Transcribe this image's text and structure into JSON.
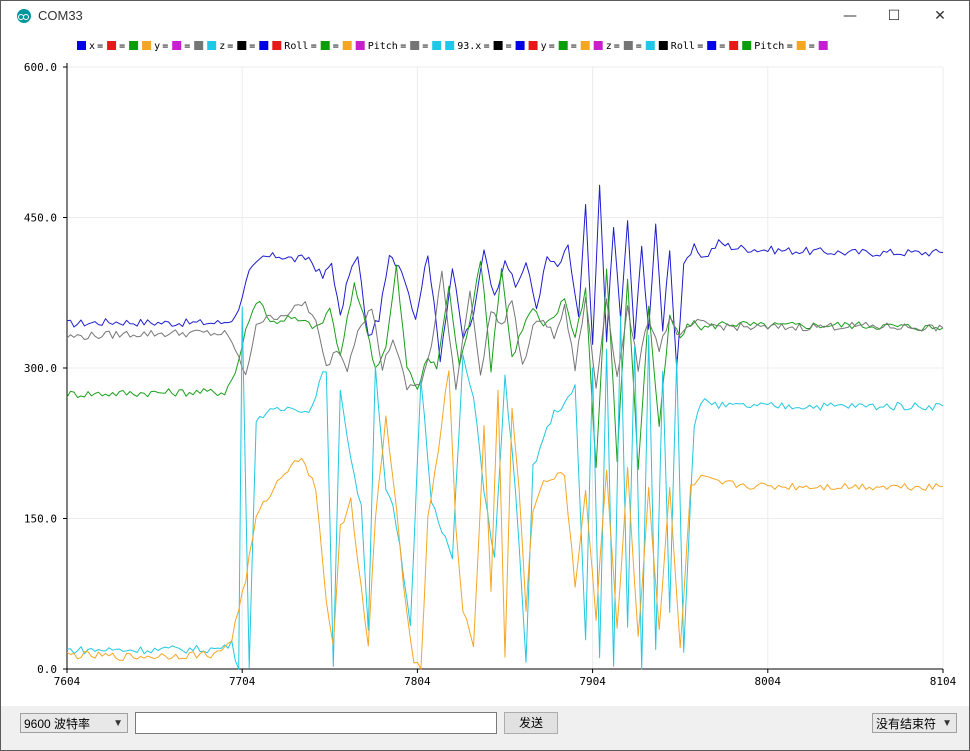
{
  "window": {
    "title": "COM33",
    "minimize": "—",
    "maximize": "☐",
    "close": "✕"
  },
  "legend": [
    {
      "label": "x",
      "color": "#0000e6",
      "sep": "="
    },
    {
      "label": "",
      "color": "#e61919",
      "sep": "="
    },
    {
      "label": "",
      "color": "#0a9e0a",
      "sep": ""
    },
    {
      "label": "y",
      "color": "#f5a623",
      "sep": "="
    },
    {
      "label": "",
      "color": "#c81ecf",
      "sep": "="
    },
    {
      "label": "",
      "color": "#757575",
      "sep": ""
    },
    {
      "label": "z",
      "color": "#1ec8e6",
      "sep": "="
    },
    {
      "label": "",
      "color": "#000000",
      "sep": "="
    },
    {
      "label": "",
      "color": "#0000e6",
      "sep": ""
    },
    {
      "label": "Roll",
      "color": "#e61919",
      "sep": "="
    },
    {
      "label": "",
      "color": "#0a9e0a",
      "sep": "="
    },
    {
      "label": "",
      "color": "#f5a623",
      "sep": ""
    },
    {
      "label": "Pitch",
      "color": "#c81ecf",
      "sep": "="
    },
    {
      "label": "",
      "color": "#757575",
      "sep": "="
    },
    {
      "label": "",
      "color": "#1ec8e6",
      "sep": ""
    },
    {
      "label": "93.x",
      "color": "#1ec8e6",
      "sep": "="
    },
    {
      "label": "",
      "color": "#000000",
      "sep": "="
    },
    {
      "label": "",
      "color": "#0000e6",
      "sep": ""
    },
    {
      "label": "y",
      "color": "#e61919",
      "sep": "="
    },
    {
      "label": "",
      "color": "#0a9e0a",
      "sep": "="
    },
    {
      "label": "",
      "color": "#f5a623",
      "sep": ""
    },
    {
      "label": "z",
      "color": "#c81ecf",
      "sep": "="
    },
    {
      "label": "",
      "color": "#757575",
      "sep": "="
    },
    {
      "label": "",
      "color": "#1ec8e6",
      "sep": ""
    },
    {
      "label": "Roll",
      "color": "#000000",
      "sep": "="
    },
    {
      "label": "",
      "color": "#0000e6",
      "sep": "="
    },
    {
      "label": "",
      "color": "#e61919",
      "sep": ""
    },
    {
      "label": "Pitch",
      "color": "#0a9e0a",
      "sep": "="
    },
    {
      "label": "",
      "color": "#f5a623",
      "sep": "="
    },
    {
      "label": "",
      "color": "#c81ecf",
      "sep": ""
    }
  ],
  "chart_data": {
    "type": "line",
    "title": "",
    "xlabel": "",
    "ylabel": "",
    "xlim": [
      7604,
      8104
    ],
    "ylim": [
      0,
      600
    ],
    "x_ticks": [
      "7604",
      "7704",
      "7804",
      "7904",
      "8004",
      "8104"
    ],
    "y_ticks": [
      "0.0",
      "150.0",
      "300.0",
      "450.0",
      "600.0"
    ],
    "grid": true,
    "series": [
      {
        "color": "#1e1ecf",
        "anchors": [
          [
            7604,
            344
          ],
          [
            7630,
            346
          ],
          [
            7660,
            345
          ],
          [
            7692,
            345
          ],
          [
            7700,
            350
          ],
          [
            7708,
            395
          ],
          [
            7716,
            410
          ],
          [
            7725,
            412
          ],
          [
            7734,
            408
          ],
          [
            7742,
            410
          ],
          [
            7750,
            390
          ],
          [
            7755,
            405
          ],
          [
            7760,
            350
          ],
          [
            7765,
            395
          ],
          [
            7770,
            410
          ],
          [
            7776,
            330
          ],
          [
            7782,
            350
          ],
          [
            7788,
            410
          ],
          [
            7795,
            400
          ],
          [
            7803,
            350
          ],
          [
            7810,
            415
          ],
          [
            7817,
            310
          ],
          [
            7824,
            400
          ],
          [
            7830,
            330
          ],
          [
            7836,
            350
          ],
          [
            7842,
            420
          ],
          [
            7848,
            370
          ],
          [
            7854,
            410
          ],
          [
            7860,
            380
          ],
          [
            7866,
            405
          ],
          [
            7872,
            360
          ],
          [
            7878,
            410
          ],
          [
            7884,
            400
          ],
          [
            7890,
            420
          ],
          [
            7896,
            350
          ],
          [
            7900,
            460
          ],
          [
            7904,
            320
          ],
          [
            7908,
            480
          ],
          [
            7912,
            330
          ],
          [
            7916,
            440
          ],
          [
            7920,
            350
          ],
          [
            7924,
            445
          ],
          [
            7928,
            330
          ],
          [
            7932,
            420
          ],
          [
            7936,
            340
          ],
          [
            7940,
            440
          ],
          [
            7944,
            340
          ],
          [
            7948,
            420
          ],
          [
            7952,
            300
          ],
          [
            7956,
            400
          ],
          [
            7962,
            420
          ],
          [
            7968,
            410
          ],
          [
            7976,
            425
          ],
          [
            7985,
            420
          ],
          [
            8000,
            418
          ],
          [
            8050,
            415
          ],
          [
            8104,
            415
          ]
        ]
      },
      {
        "color": "#1a9e1a",
        "anchors": [
          [
            7604,
            274
          ],
          [
            7640,
            275
          ],
          [
            7680,
            276
          ],
          [
            7694,
            276
          ],
          [
            7700,
            295
          ],
          [
            7708,
            350
          ],
          [
            7714,
            370
          ],
          [
            7720,
            345
          ],
          [
            7730,
            350
          ],
          [
            7740,
            345
          ],
          [
            7748,
            340
          ],
          [
            7754,
            360
          ],
          [
            7760,
            310
          ],
          [
            7768,
            385
          ],
          [
            7775,
            340
          ],
          [
            7780,
            300
          ],
          [
            7786,
            320
          ],
          [
            7792,
            400
          ],
          [
            7798,
            300
          ],
          [
            7804,
            280
          ],
          [
            7810,
            310
          ],
          [
            7815,
            300
          ],
          [
            7822,
            380
          ],
          [
            7828,
            300
          ],
          [
            7834,
            350
          ],
          [
            7840,
            410
          ],
          [
            7846,
            300
          ],
          [
            7852,
            400
          ],
          [
            7858,
            310
          ],
          [
            7864,
            340
          ],
          [
            7870,
            360
          ],
          [
            7876,
            340
          ],
          [
            7882,
            350
          ],
          [
            7888,
            370
          ],
          [
            7894,
            330
          ],
          [
            7900,
            380
          ],
          [
            7906,
            200
          ],
          [
            7912,
            400
          ],
          [
            7918,
            210
          ],
          [
            7924,
            390
          ],
          [
            7930,
            200
          ],
          [
            7936,
            360
          ],
          [
            7942,
            240
          ],
          [
            7948,
            350
          ],
          [
            7954,
            330
          ],
          [
            7960,
            345
          ],
          [
            7968,
            340
          ],
          [
            7980,
            345
          ],
          [
            8000,
            342
          ],
          [
            8050,
            343
          ],
          [
            8104,
            340
          ]
        ]
      },
      {
        "color": "#777777",
        "anchors": [
          [
            7604,
            331
          ],
          [
            7640,
            334
          ],
          [
            7680,
            335
          ],
          [
            7694,
            334
          ],
          [
            7700,
            320
          ],
          [
            7706,
            290
          ],
          [
            7712,
            345
          ],
          [
            7720,
            350
          ],
          [
            7730,
            355
          ],
          [
            7740,
            365
          ],
          [
            7746,
            345
          ],
          [
            7752,
            300
          ],
          [
            7758,
            320
          ],
          [
            7764,
            300
          ],
          [
            7770,
            340
          ],
          [
            7778,
            360
          ],
          [
            7784,
            300
          ],
          [
            7790,
            330
          ],
          [
            7798,
            280
          ],
          [
            7806,
            285
          ],
          [
            7812,
            320
          ],
          [
            7818,
            395
          ],
          [
            7826,
            280
          ],
          [
            7834,
            380
          ],
          [
            7840,
            290
          ],
          [
            7846,
            360
          ],
          [
            7852,
            340
          ],
          [
            7858,
            370
          ],
          [
            7864,
            300
          ],
          [
            7870,
            340
          ],
          [
            7876,
            350
          ],
          [
            7882,
            330
          ],
          [
            7888,
            360
          ],
          [
            7894,
            300
          ],
          [
            7900,
            370
          ],
          [
            7906,
            280
          ],
          [
            7912,
            370
          ],
          [
            7918,
            290
          ],
          [
            7924,
            360
          ],
          [
            7930,
            300
          ],
          [
            7936,
            350
          ],
          [
            7942,
            320
          ],
          [
            7948,
            350
          ],
          [
            7954,
            330
          ],
          [
            7962,
            345
          ],
          [
            7975,
            342
          ],
          [
            8000,
            340
          ],
          [
            8050,
            342
          ],
          [
            8104,
            340
          ]
        ]
      },
      {
        "color": "#22c8e0",
        "anchors": [
          [
            7604,
            19
          ],
          [
            7640,
            19
          ],
          [
            7690,
            20
          ],
          [
            7698,
            25
          ],
          [
            7702,
            0
          ],
          [
            7704,
            360
          ],
          [
            7708,
            0
          ],
          [
            7712,
            250
          ],
          [
            7718,
            255
          ],
          [
            7726,
            258
          ],
          [
            7734,
            262
          ],
          [
            7742,
            255
          ],
          [
            7748,
            285
          ],
          [
            7752,
            300
          ],
          [
            7756,
            0
          ],
          [
            7760,
            280
          ],
          [
            7766,
            210
          ],
          [
            7772,
            160
          ],
          [
            7776,
            40
          ],
          [
            7780,
            300
          ],
          [
            7786,
            180
          ],
          [
            7790,
            160
          ],
          [
            7794,
            120
          ],
          [
            7800,
            40
          ],
          [
            7806,
            290
          ],
          [
            7812,
            170
          ],
          [
            7818,
            140
          ],
          [
            7824,
            110
          ],
          [
            7830,
            310
          ],
          [
            7836,
            270
          ],
          [
            7842,
            180
          ],
          [
            7848,
            110
          ],
          [
            7854,
            290
          ],
          [
            7860,
            180
          ],
          [
            7866,
            5
          ],
          [
            7870,
            200
          ],
          [
            7876,
            230
          ],
          [
            7882,
            255
          ],
          [
            7888,
            265
          ],
          [
            7894,
            280
          ],
          [
            7900,
            30
          ],
          [
            7904,
            300
          ],
          [
            7908,
            10
          ],
          [
            7912,
            320
          ],
          [
            7916,
            0
          ],
          [
            7920,
            350
          ],
          [
            7924,
            40
          ],
          [
            7928,
            320
          ],
          [
            7932,
            0
          ],
          [
            7936,
            330
          ],
          [
            7940,
            20
          ],
          [
            7944,
            300
          ],
          [
            7948,
            60
          ],
          [
            7952,
            310
          ],
          [
            7956,
            20
          ],
          [
            7962,
            245
          ],
          [
            7968,
            270
          ],
          [
            7976,
            262
          ],
          [
            7990,
            262
          ],
          [
            8030,
            262
          ],
          [
            8104,
            262
          ]
        ]
      },
      {
        "color": "#f5a623",
        "anchors": [
          [
            7604,
            14
          ],
          [
            7640,
            12
          ],
          [
            7690,
            15
          ],
          [
            7698,
            30
          ],
          [
            7702,
            60
          ],
          [
            7706,
            90
          ],
          [
            7712,
            150
          ],
          [
            7718,
            170
          ],
          [
            7726,
            190
          ],
          [
            7734,
            210
          ],
          [
            7740,
            205
          ],
          [
            7746,
            180
          ],
          [
            7752,
            70
          ],
          [
            7756,
            20
          ],
          [
            7760,
            140
          ],
          [
            7766,
            170
          ],
          [
            7772,
            80
          ],
          [
            7776,
            20
          ],
          [
            7780,
            150
          ],
          [
            7786,
            250
          ],
          [
            7792,
            160
          ],
          [
            7796,
            80
          ],
          [
            7802,
            10
          ],
          [
            7806,
            0
          ],
          [
            7810,
            150
          ],
          [
            7816,
            220
          ],
          [
            7822,
            300
          ],
          [
            7826,
            140
          ],
          [
            7830,
            60
          ],
          [
            7836,
            20
          ],
          [
            7842,
            240
          ],
          [
            7846,
            80
          ],
          [
            7850,
            280
          ],
          [
            7854,
            10
          ],
          [
            7858,
            260
          ],
          [
            7862,
            180
          ],
          [
            7866,
            60
          ],
          [
            7870,
            160
          ],
          [
            7876,
            185
          ],
          [
            7882,
            190
          ],
          [
            7888,
            195
          ],
          [
            7894,
            80
          ],
          [
            7900,
            180
          ],
          [
            7906,
            50
          ],
          [
            7912,
            200
          ],
          [
            7918,
            40
          ],
          [
            7924,
            200
          ],
          [
            7930,
            30
          ],
          [
            7936,
            180
          ],
          [
            7942,
            40
          ],
          [
            7948,
            180
          ],
          [
            7954,
            20
          ],
          [
            7960,
            180
          ],
          [
            7966,
            190
          ],
          [
            7976,
            185
          ],
          [
            8000,
            182
          ],
          [
            8050,
            182
          ],
          [
            8104,
            182
          ]
        ]
      }
    ]
  },
  "bottom": {
    "baud": "9600 波特率",
    "send_value": "",
    "send": "发送",
    "line_ending": "没有结束符"
  }
}
